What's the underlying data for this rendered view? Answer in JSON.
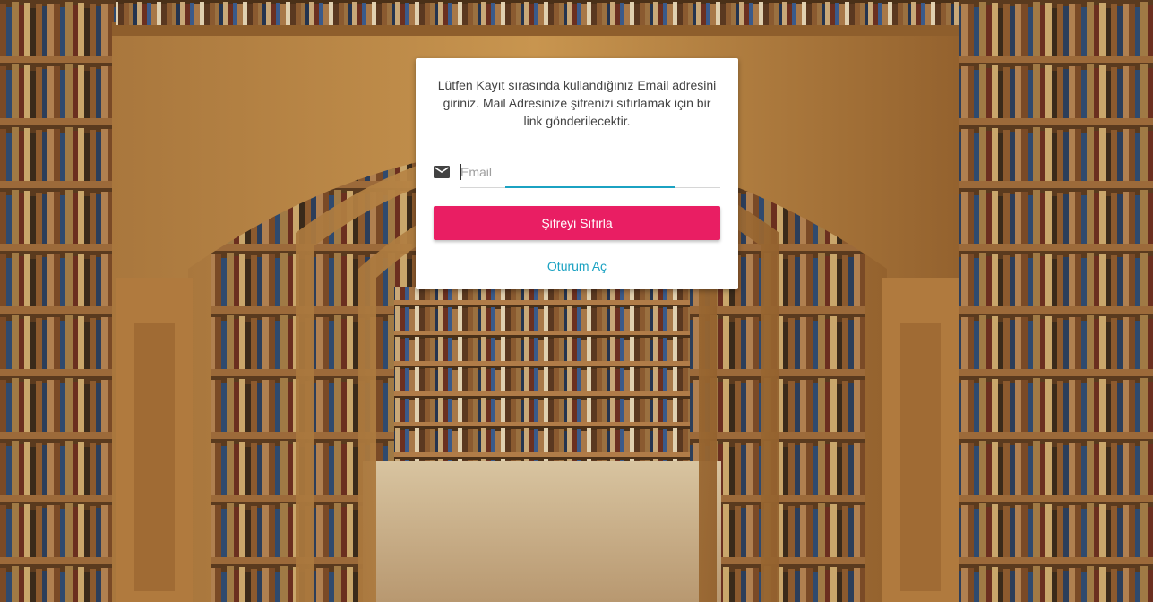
{
  "background": {
    "description_icon": "library-arches-background"
  },
  "reset_form": {
    "info_text": "Lütfen Kayıt sırasında kullandığınız Email adresini giriniz. Mail Adresinize şifrenizi sıfırlamak için bir link gönderilecektir.",
    "email_placeholder": "Email",
    "email_value": "",
    "email_icon": "mail-icon",
    "submit_label": "Şifreyi Sıfırla",
    "login_link_label": "Oturum Aç"
  },
  "colors": {
    "accent_button": "#e91e63",
    "accent_link": "#1ba2c2",
    "card_background": "#ffffff"
  }
}
